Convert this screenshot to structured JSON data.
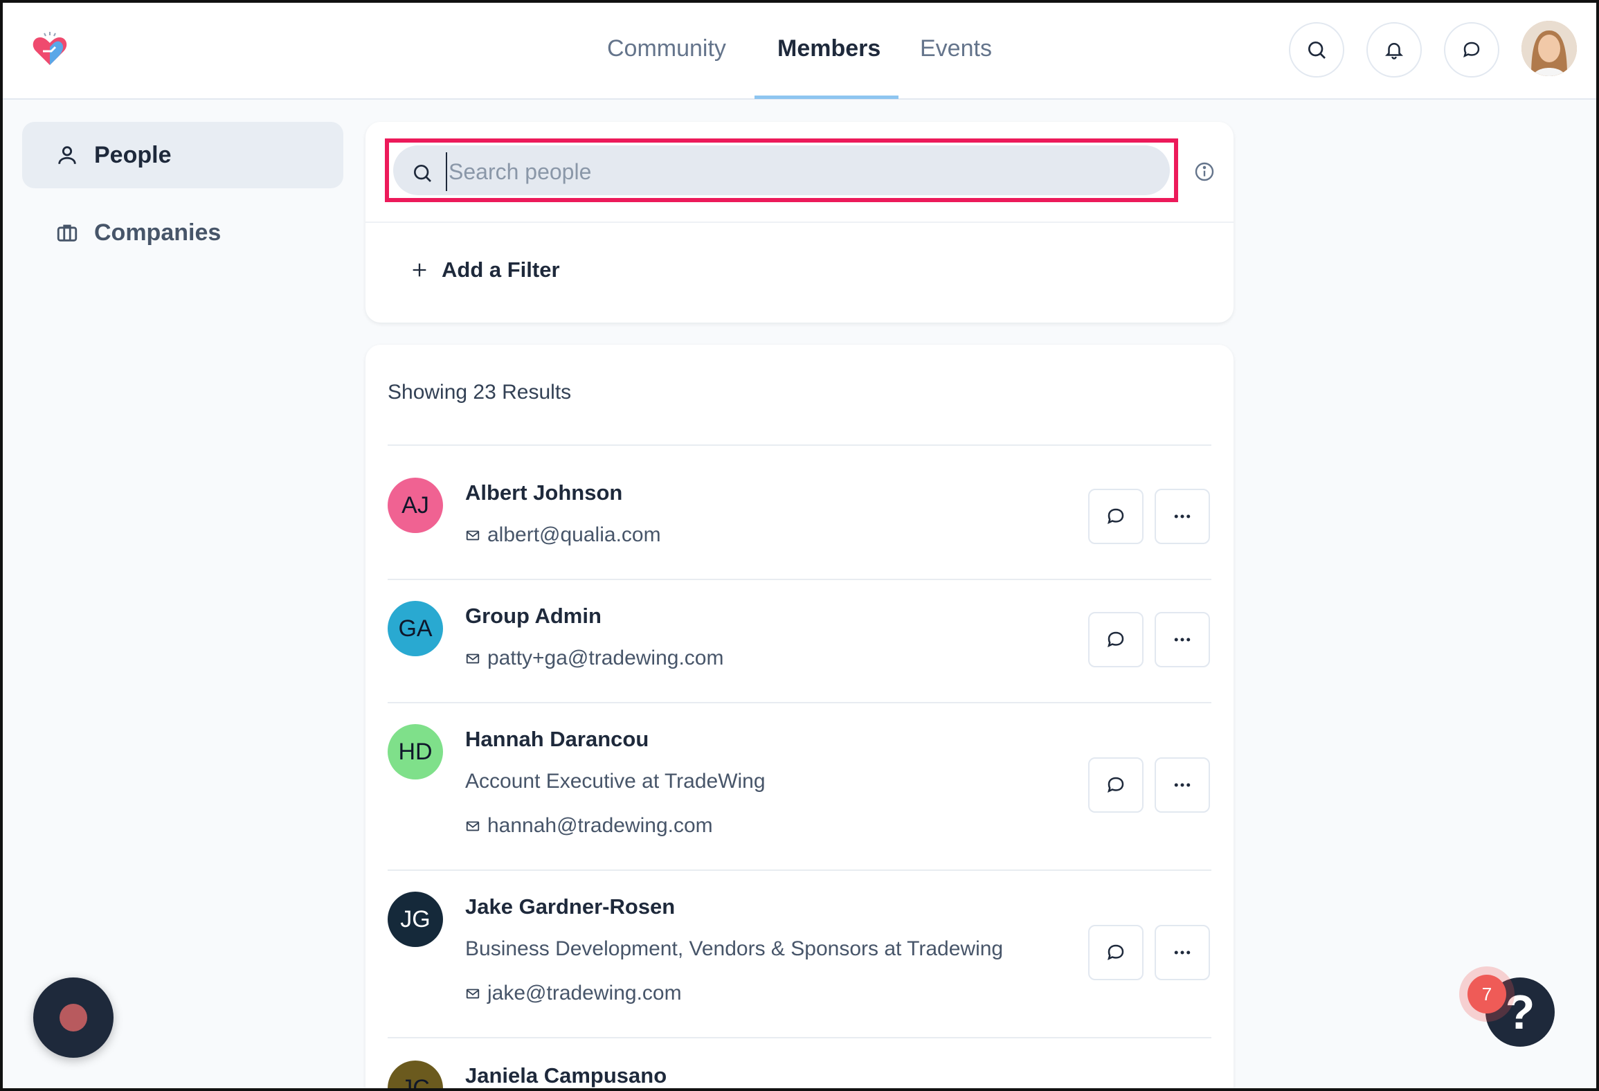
{
  "nav": {
    "tabs": [
      {
        "label": "Community",
        "active": false
      },
      {
        "label": "Members",
        "active": true
      },
      {
        "label": "Events",
        "active": false
      }
    ],
    "icons": [
      "search-icon",
      "bell-icon",
      "chat-icon"
    ]
  },
  "sidebar": {
    "items": [
      {
        "label": "People",
        "icon": "person-icon",
        "active": true
      },
      {
        "label": "Companies",
        "icon": "briefcase-icon",
        "active": false
      }
    ]
  },
  "search": {
    "placeholder": "Search people",
    "value": "",
    "add_filter_label": "Add a Filter"
  },
  "results": {
    "count_label": "Showing 23 Results",
    "members": [
      {
        "initials": "AJ",
        "name": "Albert Johnson",
        "title": "",
        "email": "albert@qualia.com",
        "color": "#f06292"
      },
      {
        "initials": "GA",
        "name": "Group Admin",
        "title": "",
        "email": "patty+ga@tradewing.com",
        "color": "#29a9d1"
      },
      {
        "initials": "HD",
        "name": "Hannah Darancou",
        "title": "Account Executive at TradeWing",
        "email": "hannah@tradewing.com",
        "color": "#7fe08a"
      },
      {
        "initials": "JG",
        "name": "Jake Gardner-Rosen",
        "title": "Business Development, Vendors & Sponsors at Tradewing",
        "email": "jake@tradewing.com",
        "color": "#15293a"
      },
      {
        "initials": "JC",
        "name": "Janiela Campusano",
        "title": "",
        "email": "",
        "color": "#6b5a1e"
      }
    ]
  },
  "help": {
    "badge_count": "7",
    "label": "?"
  },
  "colors": {
    "accent_underline": "#8ec5f0",
    "highlight_border": "#ec1a5a"
  }
}
